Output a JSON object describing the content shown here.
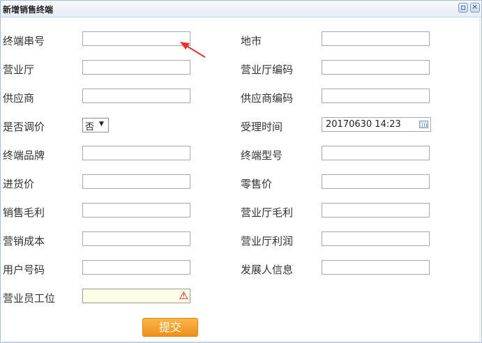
{
  "dialog": {
    "title": "新增销售终端",
    "minimize_icon": "restore-icon",
    "close_icon": "close-icon"
  },
  "form": {
    "terminal_serial": {
      "label": "终端串号",
      "value": ""
    },
    "city": {
      "label": "地市",
      "value": ""
    },
    "branch": {
      "label": "营业厅",
      "value": ""
    },
    "branch_code": {
      "label": "营业厅编码",
      "value": ""
    },
    "supplier": {
      "label": "供应商",
      "value": ""
    },
    "supplier_code": {
      "label": "供应商编码",
      "value": ""
    },
    "price_adjusted": {
      "label": "是否调价",
      "selected": "否"
    },
    "accept_time": {
      "label": "受理时间",
      "value": "20170630 14:23"
    },
    "terminal_brand": {
      "label": "终端品牌",
      "value": ""
    },
    "terminal_model": {
      "label": "终端型号",
      "value": ""
    },
    "purchase_price": {
      "label": "进货价",
      "value": ""
    },
    "retail_price": {
      "label": "零售价",
      "value": ""
    },
    "sales_margin": {
      "label": "销售毛利",
      "value": ""
    },
    "branch_margin": {
      "label": "营业厅毛利",
      "value": ""
    },
    "marketing_cost": {
      "label": "营销成本",
      "value": ""
    },
    "branch_profit": {
      "label": "营业厅利润",
      "value": ""
    },
    "user_number": {
      "label": "用户号码",
      "value": ""
    },
    "developer_info": {
      "label": "发展人信息",
      "value": ""
    },
    "staff_id": {
      "label": "营业员工位",
      "value": "",
      "status_icon": "warning-icon"
    }
  },
  "submit_label": "提交",
  "colors": {
    "submit_bg": "#f49a1f",
    "warning_bg": "#ffffe5",
    "annotation_arrow": "#e8312a"
  }
}
